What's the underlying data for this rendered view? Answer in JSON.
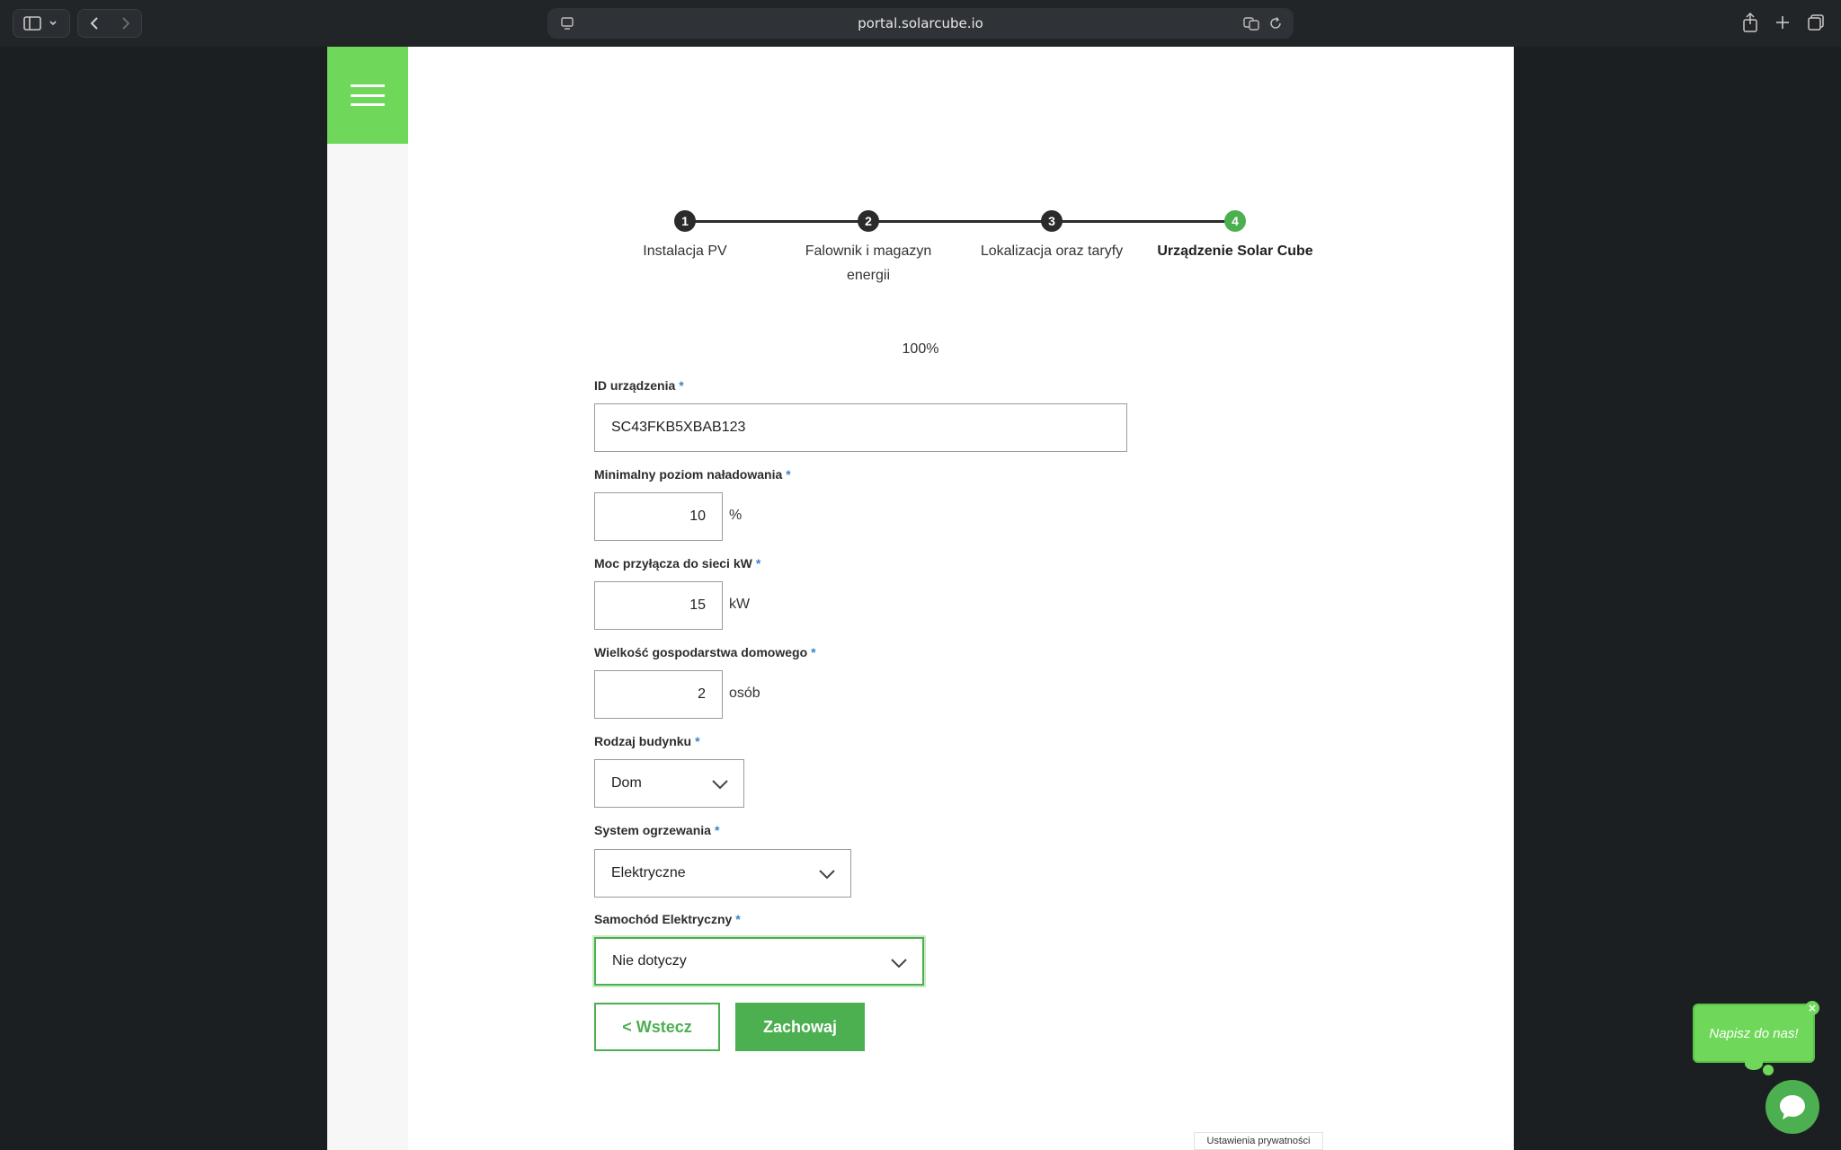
{
  "browser": {
    "url": "portal.solarcube.io"
  },
  "stepper": {
    "steps": [
      {
        "number": "1",
        "label": "Instalacja PV"
      },
      {
        "number": "2",
        "label": "Falownik i magazyn energii"
      },
      {
        "number": "3",
        "label": "Lokalizacja oraz taryfy"
      },
      {
        "number": "4",
        "label": "Urządzenie Solar Cube"
      }
    ],
    "active_step": 4
  },
  "progress": {
    "text": "100%",
    "value": 100
  },
  "form": {
    "required_marker": "*",
    "device_id": {
      "label": "ID urządzenia",
      "value": "SC43FKB5XBAB123"
    },
    "min_charge": {
      "label": "Minimalny poziom naładowania",
      "value": "10",
      "unit": "%"
    },
    "grid_power": {
      "label": "Moc przyłącza do sieci kW",
      "value": "15",
      "unit": "kW"
    },
    "household_size": {
      "label": "Wielkość gospodarstwa domowego",
      "value": "2",
      "unit": "osób"
    },
    "building_type": {
      "label": "Rodzaj budynku",
      "value": "Dom"
    },
    "heating_system": {
      "label": "System ogrzewania",
      "value": "Elektryczne"
    },
    "electric_car": {
      "label": "Samochód Elektryczny",
      "value": "Nie dotyczy"
    },
    "back_label": "< Wstecz",
    "save_label": "Zachowaj"
  },
  "footer": {
    "privacy_label": "Ustawienia prywatności"
  },
  "chat": {
    "bubble_text": "Napisz do nas!",
    "close_glyph": "×"
  },
  "colors": {
    "accent": "#4caf50",
    "menu_green": "#6fd85a",
    "required": "#3b82c4"
  }
}
